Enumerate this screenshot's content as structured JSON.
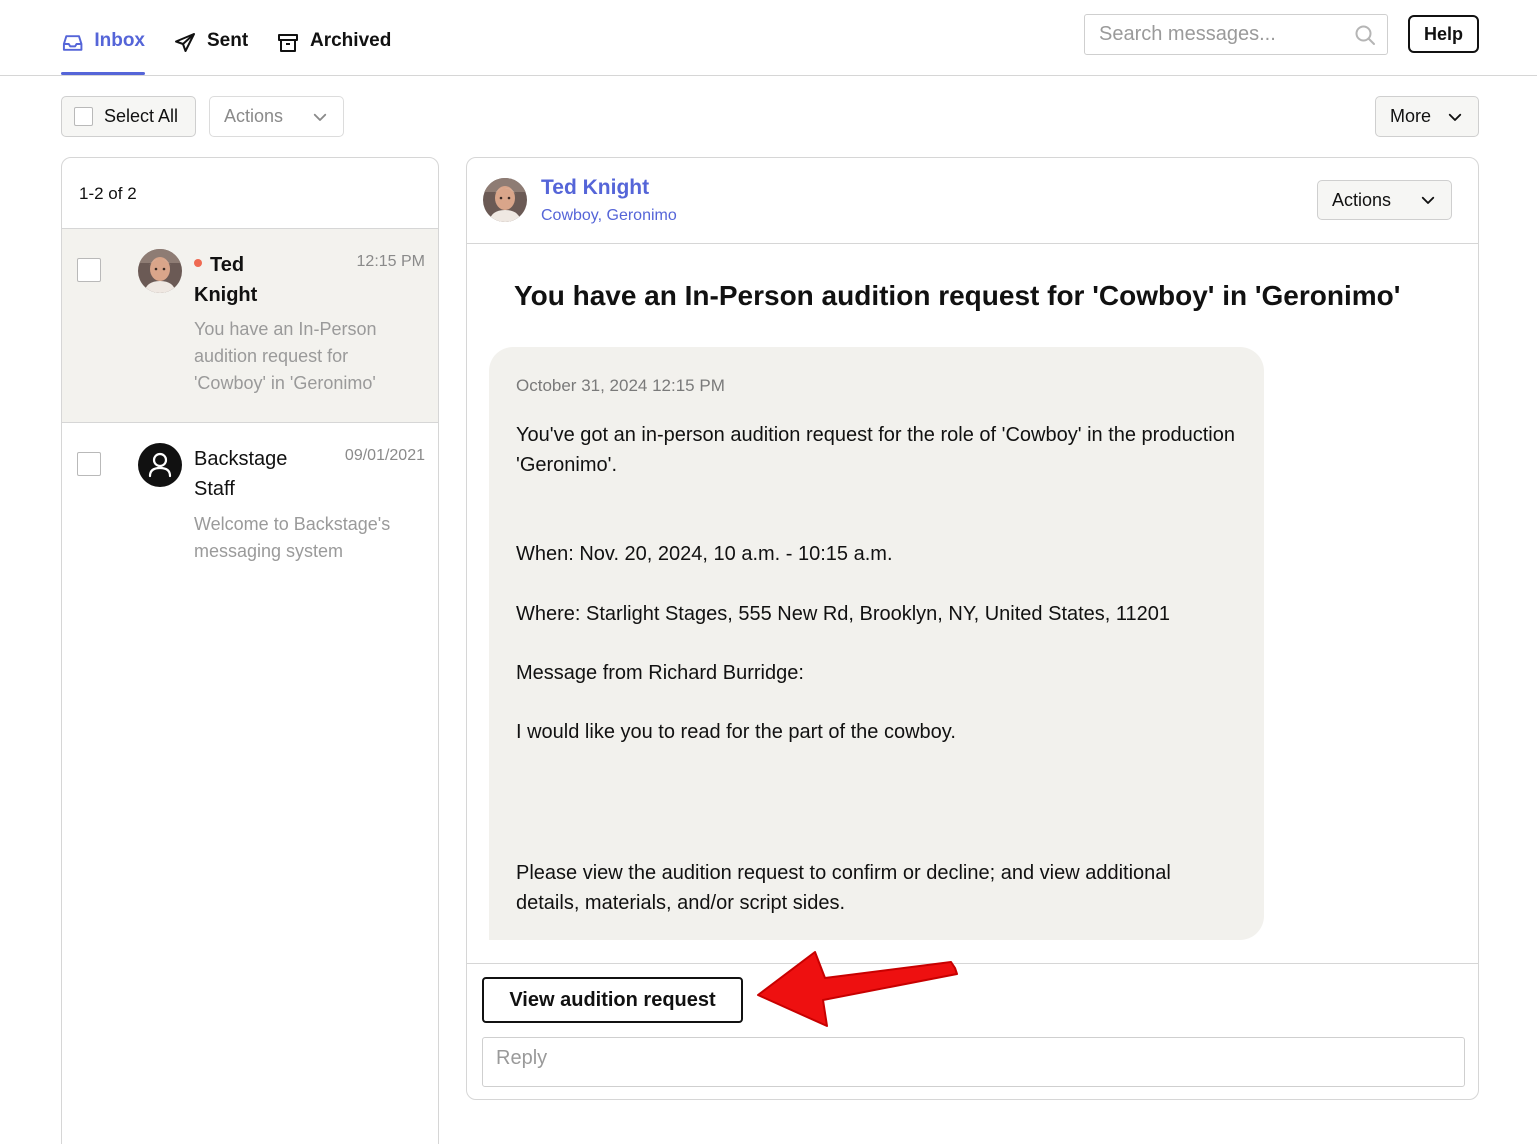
{
  "nav": {
    "tabs": [
      {
        "label": "Inbox",
        "icon": "inbox-icon",
        "active": true
      },
      {
        "label": "Sent",
        "icon": "paper-plane-icon",
        "active": false
      },
      {
        "label": "Archived",
        "icon": "archive-box-icon",
        "active": false
      }
    ],
    "search_placeholder": "Search messages...",
    "help_label": "Help"
  },
  "toolbar": {
    "select_all_label": "Select All",
    "actions_label": "Actions",
    "more_label": "More"
  },
  "list": {
    "count_label": "1-2 of 2",
    "items": [
      {
        "sender_first": "Ted",
        "sender_last": "Knight",
        "time": "12:15 PM",
        "unread": true,
        "preview": "You have an In-Person audition request for 'Cowboy' in 'Geronimo'"
      },
      {
        "sender_first": "Backstage",
        "sender_last": "Staff",
        "time": "09/01/2021",
        "unread": false,
        "preview": "Welcome to Backstage's messaging system"
      }
    ]
  },
  "message": {
    "sender_name": "Ted Knight",
    "sender_subtitle": "Cowboy, Geronimo",
    "actions_label": "Actions",
    "subject": "You have an In-Person audition request for 'Cowboy' in 'Geronimo'",
    "date": "October 31, 2024 12:15 PM",
    "intro": "You've got an in-person audition request for the role of 'Cowboy' in the production 'Geronimo'.",
    "when": "When: Nov. 20, 2024, 10 a.m. - 10:15 a.m.",
    "where": "Where: Starlight Stages, 555 New Rd, Brooklyn, NY, United States, 11201",
    "message_from": "Message from Richard Burridge:",
    "note": "I would like you to read for the part of the cowboy.",
    "closing": "Please view the audition request to confirm or decline; and view additional details, materials, and/or script sides.",
    "view_button_label": "View audition request",
    "reply_placeholder": "Reply"
  },
  "colors": {
    "accent": "#5565d8",
    "unread_dot": "#ef6a52",
    "bubble_bg": "#f2f1ed",
    "annotation_arrow": "#ee1010"
  }
}
